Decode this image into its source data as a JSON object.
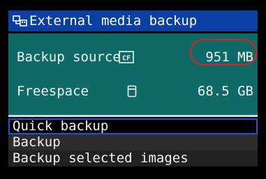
{
  "header": {
    "title": "External media backup",
    "icon": "connect-icon"
  },
  "info": {
    "source_label": "Backup source",
    "source_icon": "cf-card-icon",
    "source_value": "951 MB",
    "free_label": "Freespace",
    "free_icon": "external-drive-icon",
    "free_value": "68.5 GB"
  },
  "menu": {
    "items": [
      {
        "label": "Quick backup",
        "selected": true
      },
      {
        "label": "Backup",
        "selected": false
      },
      {
        "label": "Backup selected images",
        "selected": false
      }
    ]
  },
  "colors": {
    "title_bar": "#0b3fa3",
    "info_panel": "#0e6a66",
    "highlight": "#e02020",
    "selection": "#1c55d6"
  }
}
